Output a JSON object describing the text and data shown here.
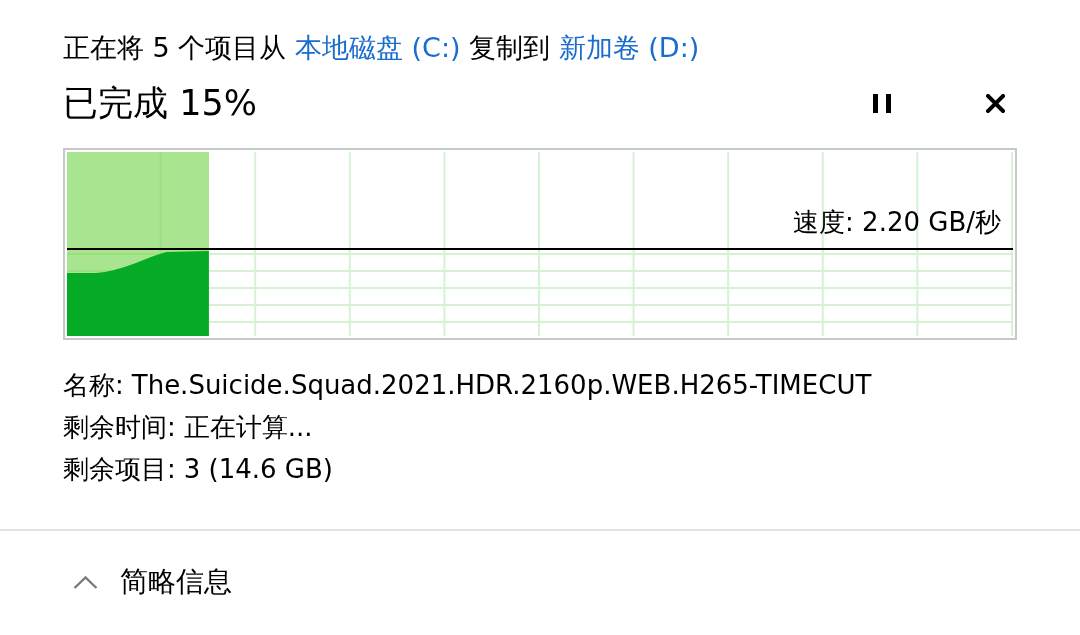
{
  "dialog": {
    "status_parts": [
      {
        "kind": "text",
        "text": "正在将 5 个项目从 "
      },
      {
        "kind": "link",
        "text": "本地磁盘 (C:)"
      },
      {
        "kind": "text",
        "text": " 复制到 "
      },
      {
        "kind": "link",
        "text": "新加卷 (D:)"
      }
    ],
    "heading": "已完成 15%",
    "graph": {
      "level": 0.15,
      "speed": "速度: 2.20 GB/秒"
    },
    "details": [
      {
        "label": "名称:",
        "value": "The.Suicide.Squad.2021.HDR.2160p.WEB.H265-TIMECUT"
      },
      {
        "label": "剩余时间:",
        "value": "正在计算..."
      },
      {
        "label": "剩余项目:",
        "value": "3 (14.6 GB)"
      }
    ],
    "details_toggle": {
      "label": "简略信息",
      "expanded": true
    }
  }
}
